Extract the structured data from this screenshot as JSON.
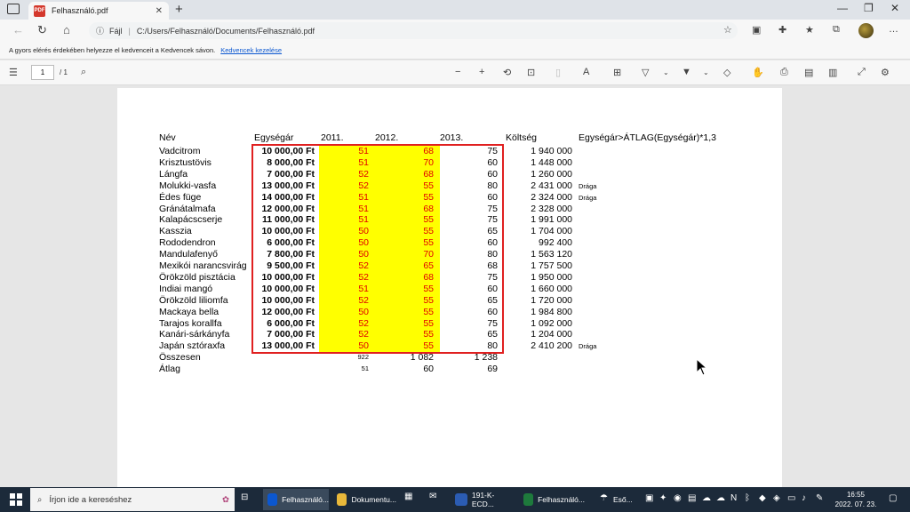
{
  "browser": {
    "tab_title": "Felhasználó.pdf",
    "pdf_badge": "PDF",
    "url_label": "Fájl",
    "url_path": "C:/Users/Felhasználó/Documents/Felhasználó.pdf",
    "favorites_notice": "A gyors elérés érdekében helyezze el kedvenceit a Kedvencek sávon.",
    "favorites_link": "Kedvencek kezelése"
  },
  "pdf_toolbar": {
    "page_current": "1",
    "page_total": "/ 1"
  },
  "table": {
    "headers": [
      "Név",
      "Egységár",
      "2011.",
      "2012.",
      "2013.",
      "Költség",
      "Egységár>ÁTLAG(Egységár)*1,3"
    ],
    "rows": [
      {
        "name": "Vadcitrom",
        "price": "10 000,00 Ft",
        "y2011": "51",
        "y2012": "68",
        "y2013": "75",
        "cost": "1 940 000",
        "note": ""
      },
      {
        "name": "Krisztustövis",
        "price": "8 000,00 Ft",
        "y2011": "51",
        "y2012": "70",
        "y2013": "60",
        "cost": "1 448 000",
        "note": ""
      },
      {
        "name": "Lángfa",
        "price": "7 000,00 Ft",
        "y2011": "52",
        "y2012": "68",
        "y2013": "60",
        "cost": "1 260 000",
        "note": ""
      },
      {
        "name": "Molukki-vasfa",
        "price": "13 000,00 Ft",
        "y2011": "52",
        "y2012": "55",
        "y2013": "80",
        "cost": "2 431 000",
        "note": "Drága"
      },
      {
        "name": "Édes füge",
        "price": "14 000,00 Ft",
        "y2011": "51",
        "y2012": "55",
        "y2013": "60",
        "cost": "2 324 000",
        "note": "Drága"
      },
      {
        "name": "Gránátalmafa",
        "price": "12 000,00 Ft",
        "y2011": "51",
        "y2012": "68",
        "y2013": "75",
        "cost": "2 328 000",
        "note": ""
      },
      {
        "name": "Kalapácscserje",
        "price": "11 000,00 Ft",
        "y2011": "51",
        "y2012": "55",
        "y2013": "75",
        "cost": "1 991 000",
        "note": ""
      },
      {
        "name": "Kasszia",
        "price": "10 000,00 Ft",
        "y2011": "50",
        "y2012": "55",
        "y2013": "65",
        "cost": "1 704 000",
        "note": ""
      },
      {
        "name": "Rododendron",
        "price": "6 000,00 Ft",
        "y2011": "50",
        "y2012": "55",
        "y2013": "60",
        "cost": "992 400",
        "note": ""
      },
      {
        "name": "Mandulafenyő",
        "price": "7 800,00 Ft",
        "y2011": "50",
        "y2012": "70",
        "y2013": "80",
        "cost": "1 563 120",
        "note": ""
      },
      {
        "name": "Mexikói narancsvirág",
        "price": "9 500,00 Ft",
        "y2011": "52",
        "y2012": "65",
        "y2013": "68",
        "cost": "1 757 500",
        "note": ""
      },
      {
        "name": "Örökzöld pisztácia",
        "price": "10 000,00 Ft",
        "y2011": "52",
        "y2012": "68",
        "y2013": "75",
        "cost": "1 950 000",
        "note": ""
      },
      {
        "name": "Indiai mangó",
        "price": "10 000,00 Ft",
        "y2011": "51",
        "y2012": "55",
        "y2013": "60",
        "cost": "1 660 000",
        "note": ""
      },
      {
        "name": "Örökzöld liliomfa",
        "price": "10 000,00 Ft",
        "y2011": "52",
        "y2012": "55",
        "y2013": "65",
        "cost": "1 720 000",
        "note": ""
      },
      {
        "name": "Mackaya bella",
        "price": "12 000,00 Ft",
        "y2011": "50",
        "y2012": "55",
        "y2013": "60",
        "cost": "1 984 800",
        "note": ""
      },
      {
        "name": "Tarajos korallfa",
        "price": "6 000,00 Ft",
        "y2011": "52",
        "y2012": "55",
        "y2013": "75",
        "cost": "1 092 000",
        "note": ""
      },
      {
        "name": "Kanári-sárkányfa",
        "price": "7 000,00 Ft",
        "y2011": "52",
        "y2012": "55",
        "y2013": "65",
        "cost": "1 204 000",
        "note": ""
      },
      {
        "name": "Japán sztóraxfa",
        "price": "13 000,00 Ft",
        "y2011": "50",
        "y2012": "55",
        "y2013": "80",
        "cost": "2 410 200",
        "note": "Drága"
      }
    ],
    "total_label": "Összesen",
    "totals": {
      "y2011": "922",
      "y2012": "1 082",
      "y2013": "1 238"
    },
    "avg_label": "Átlag",
    "averages": {
      "y2011": "51",
      "y2012": "60",
      "y2013": "69"
    }
  },
  "taskbar": {
    "search_placeholder": "Írjon ide a kereséshez",
    "items": [
      "Felhasználó...",
      "Dokumentu...",
      "191-K-ECD...",
      "Felhasználó..."
    ],
    "weather": "Eső...",
    "time": "16:55",
    "date": "2022. 07. 23."
  },
  "colors": {
    "highlight_yellow": "#ffff00",
    "value_red": "#e00000",
    "frame_red": "#e02020",
    "edge_blue": "#0b57d0",
    "excel_green": "#1e7a3c",
    "word_blue": "#2b5cb3"
  }
}
